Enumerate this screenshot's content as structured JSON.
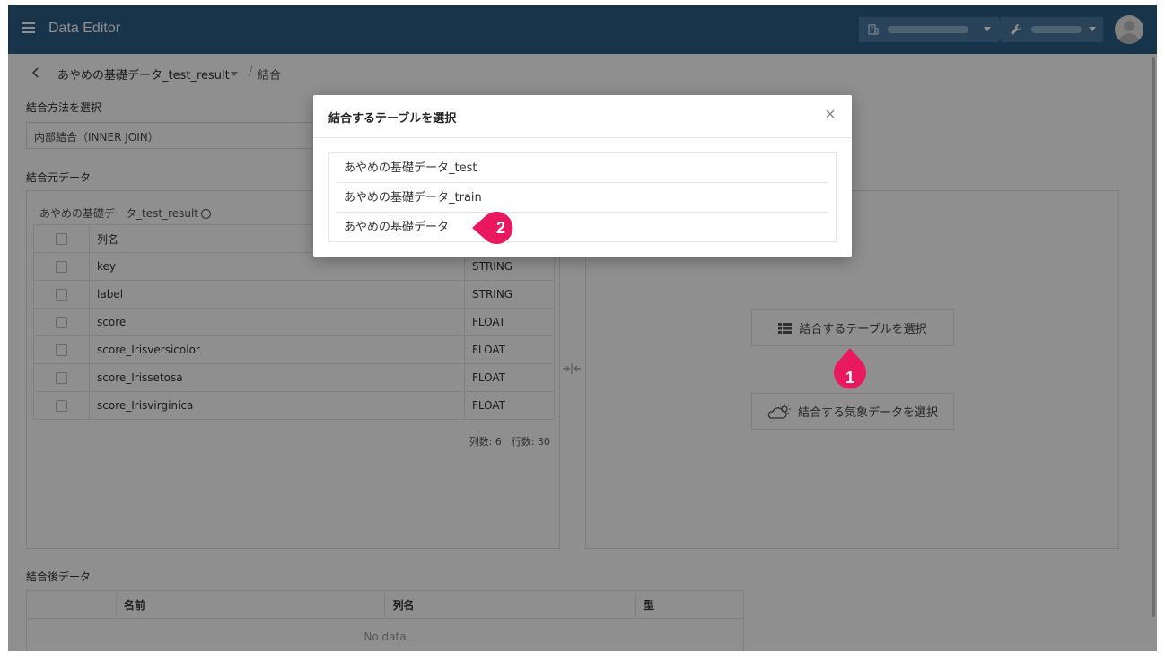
{
  "app": {
    "title": "Data Editor"
  },
  "breadcrumb": {
    "table_name": "あやめの基礎データ_test_result",
    "separator": "/",
    "current": "結合"
  },
  "join_method": {
    "label": "結合方法を選択",
    "value": "内部結合（INNER JOIN）"
  },
  "source": {
    "label": "結合元データ",
    "panel_title": "あやめの基礎データ_test_result",
    "header": {
      "name": "列名",
      "type": ""
    },
    "columns": [
      {
        "name": "key",
        "type": "STRING"
      },
      {
        "name": "label",
        "type": "STRING"
      },
      {
        "name": "score",
        "type": "FLOAT"
      },
      {
        "name": "score_Irisversicolor",
        "type": "FLOAT"
      },
      {
        "name": "score_Irissetosa",
        "type": "FLOAT"
      },
      {
        "name": "score_Irisvirginica",
        "type": "FLOAT"
      }
    ],
    "counts": "列数: 6　行数: 30"
  },
  "target": {
    "select_table_label": "結合するテーブルを選択",
    "select_weather_label": "結合する気象データを選択"
  },
  "result": {
    "label": "結合後データ",
    "headers": [
      "",
      "名前",
      "列名",
      "型"
    ],
    "empty": "No data"
  },
  "modal": {
    "title": "結合するテーブルを選択",
    "items": [
      "あやめの基礎データ_test",
      "あやめの基礎データ_train",
      "あやめの基礎データ"
    ]
  },
  "markers": {
    "one": "1",
    "two": "2",
    "color": "#e8195f"
  },
  "colors": {
    "appbar": "#2c5d84",
    "overlay": "rgba(0,0,0,0.44)"
  }
}
